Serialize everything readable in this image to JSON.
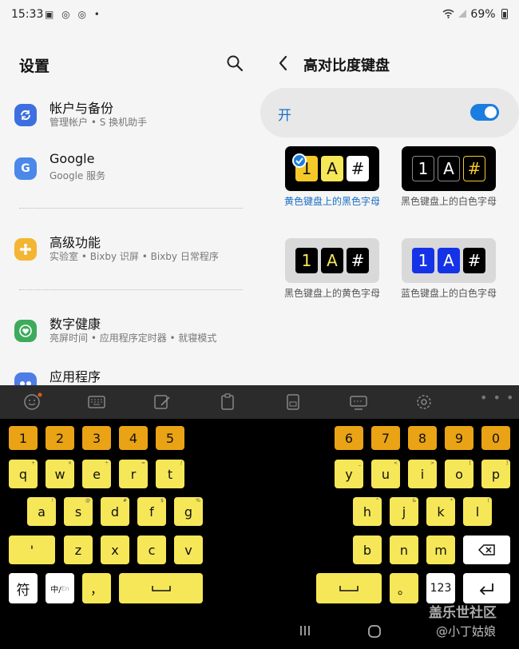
{
  "status": {
    "time": "15:33",
    "icons": "▣ ◎ ◎ •",
    "battery": "69%"
  },
  "left": {
    "title": "设置",
    "items": [
      {
        "title": "帐户与备份",
        "subtitle": "管理帐户 • S 换机助手",
        "icon": "sync-icon",
        "color": "#3d6fe0"
      },
      {
        "title": "Google",
        "subtitle": "Google 服务",
        "icon": "google-icon",
        "color": "#4a88ea"
      },
      {
        "title": "高级功能",
        "subtitle": "实验室 • Bixby 识屏 • Bixby 日常程序",
        "icon": "gear-flower-icon",
        "color": "#f4b532"
      },
      {
        "title": "数字健康",
        "subtitle": "亮屏时间 • 应用程序定时器 • 就寝模式",
        "icon": "heart-clock-icon",
        "color": "#3eaa5c"
      },
      {
        "title": "应用程序",
        "subtitle": "",
        "icon": "apps-icon",
        "color": "#4f7de6"
      }
    ]
  },
  "right": {
    "title": "高对比度键盘",
    "toggle_label": "开",
    "toggle_on": true,
    "themes": [
      {
        "caption": "黄色键盘上的黑色字母",
        "selected": true
      },
      {
        "caption": "黑色键盘上的白色字母",
        "selected": false
      },
      {
        "caption": "黑色键盘上的黄色字母",
        "selected": false
      },
      {
        "caption": "蓝色键盘上的白色字母",
        "selected": false
      }
    ],
    "sample_keys": [
      "1",
      "A",
      "#"
    ]
  },
  "keyboard": {
    "numbers_left": [
      "1",
      "2",
      "3",
      "4",
      "5"
    ],
    "numbers_right": [
      "6",
      "7",
      "8",
      "9",
      "0"
    ],
    "row1_left": [
      "q",
      "w",
      "e",
      "r",
      "t"
    ],
    "row1_right": [
      "y",
      "u",
      "i",
      "o",
      "p"
    ],
    "row1_hints": [
      "+",
      "×",
      "÷",
      "=",
      "/",
      "_",
      "<",
      ">",
      "[",
      "]"
    ],
    "row2_left": [
      "a",
      "s",
      "d",
      "f",
      "g"
    ],
    "row2_right": [
      "h",
      "j",
      "k",
      "l"
    ],
    "row2_hints": [
      "!",
      "@",
      "#",
      "$",
      "%",
      "^",
      "&",
      "*",
      "("
    ],
    "row3_left": [
      "'",
      "z",
      "x",
      "c",
      "v"
    ],
    "row3_right": [
      "b",
      "n",
      "m"
    ],
    "symbol_key": "符",
    "lang_key": "中/",
    "lang_key_sub": "En",
    "comma_key": "，",
    "period_key": "。",
    "numeric_key": "123"
  },
  "watermark": {
    "line1": "盖乐世社区",
    "line2": "@小丁姑娘"
  },
  "colors": {
    "accent": "#1a7de0",
    "key_yellow": "#f6e758",
    "key_orange": "#e9a314"
  }
}
